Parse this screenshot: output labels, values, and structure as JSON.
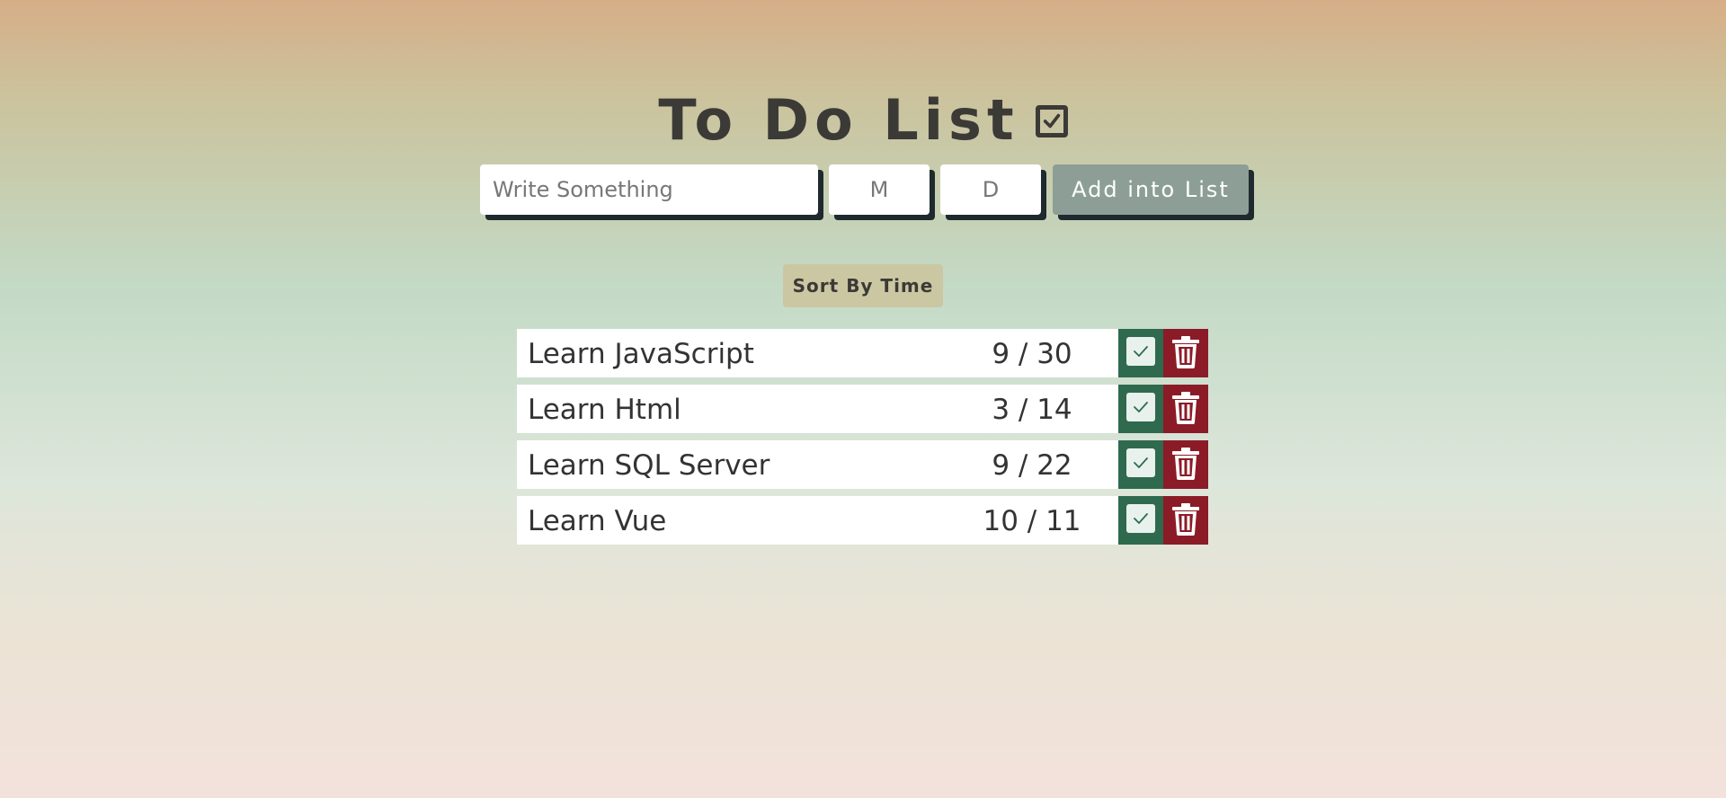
{
  "header": {
    "title": "To Do List",
    "title_icon": "checked-box-icon"
  },
  "form": {
    "text_placeholder": "Write Something",
    "text_value": "",
    "month_placeholder": "M",
    "month_value": "",
    "day_placeholder": "D",
    "day_value": "",
    "add_label": "Add into List"
  },
  "toolbar": {
    "sort_label": "Sort By Time"
  },
  "todos": [
    {
      "text": "Learn JavaScript",
      "date": "9 / 30"
    },
    {
      "text": "Learn Html",
      "date": "3 / 14"
    },
    {
      "text": "Learn SQL Server",
      "date": "9 / 22"
    },
    {
      "text": "Learn Vue",
      "date": "10 / 11"
    }
  ],
  "icons": {
    "complete": "check-icon",
    "delete": "trash-icon"
  },
  "colors": {
    "complete_bg": "#2f6a4f",
    "delete_bg": "#8b1c27",
    "add_button_bg": "#8d9e96",
    "sort_button_bg": "#cbc7a2",
    "title_color": "#3b3a36"
  }
}
